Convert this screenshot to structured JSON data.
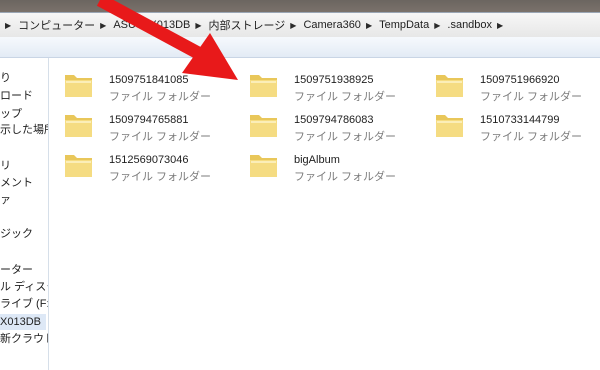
{
  "breadcrumb": [
    "コンピューター",
    "ASUS_X013DB",
    "内部ストレージ",
    "Camera360",
    "TempData",
    ".sandbox"
  ],
  "nav_items": [
    "り",
    "ロード",
    "ップ",
    "示した場所",
    "リ",
    "メント",
    "ァ",
    "ジック",
    "ーター",
    "ル ディスク",
    "ライブ (F:) A",
    "X013DB",
    "新クラウド"
  ],
  "folders": [
    {
      "name": "1509751841085",
      "type": "ファイル フォルダー"
    },
    {
      "name": "1509751938925",
      "type": "ファイル フォルダー"
    },
    {
      "name": "1509751966920",
      "type": "ファイル フォルダー"
    },
    {
      "name": "1509794765881",
      "type": "ファイル フォルダー"
    },
    {
      "name": "1509794786083",
      "type": "ファイル フォルダー"
    },
    {
      "name": "1510733144799",
      "type": "ファイル フォルダー"
    },
    {
      "name": "1512569073046",
      "type": "ファイル フォルダー"
    },
    {
      "name": "bigAlbum",
      "type": "ファイル フォルダー"
    }
  ],
  "colors": {
    "arrow": "#e8191a",
    "folder": "#f2d673",
    "selection": "#dde8f6"
  }
}
